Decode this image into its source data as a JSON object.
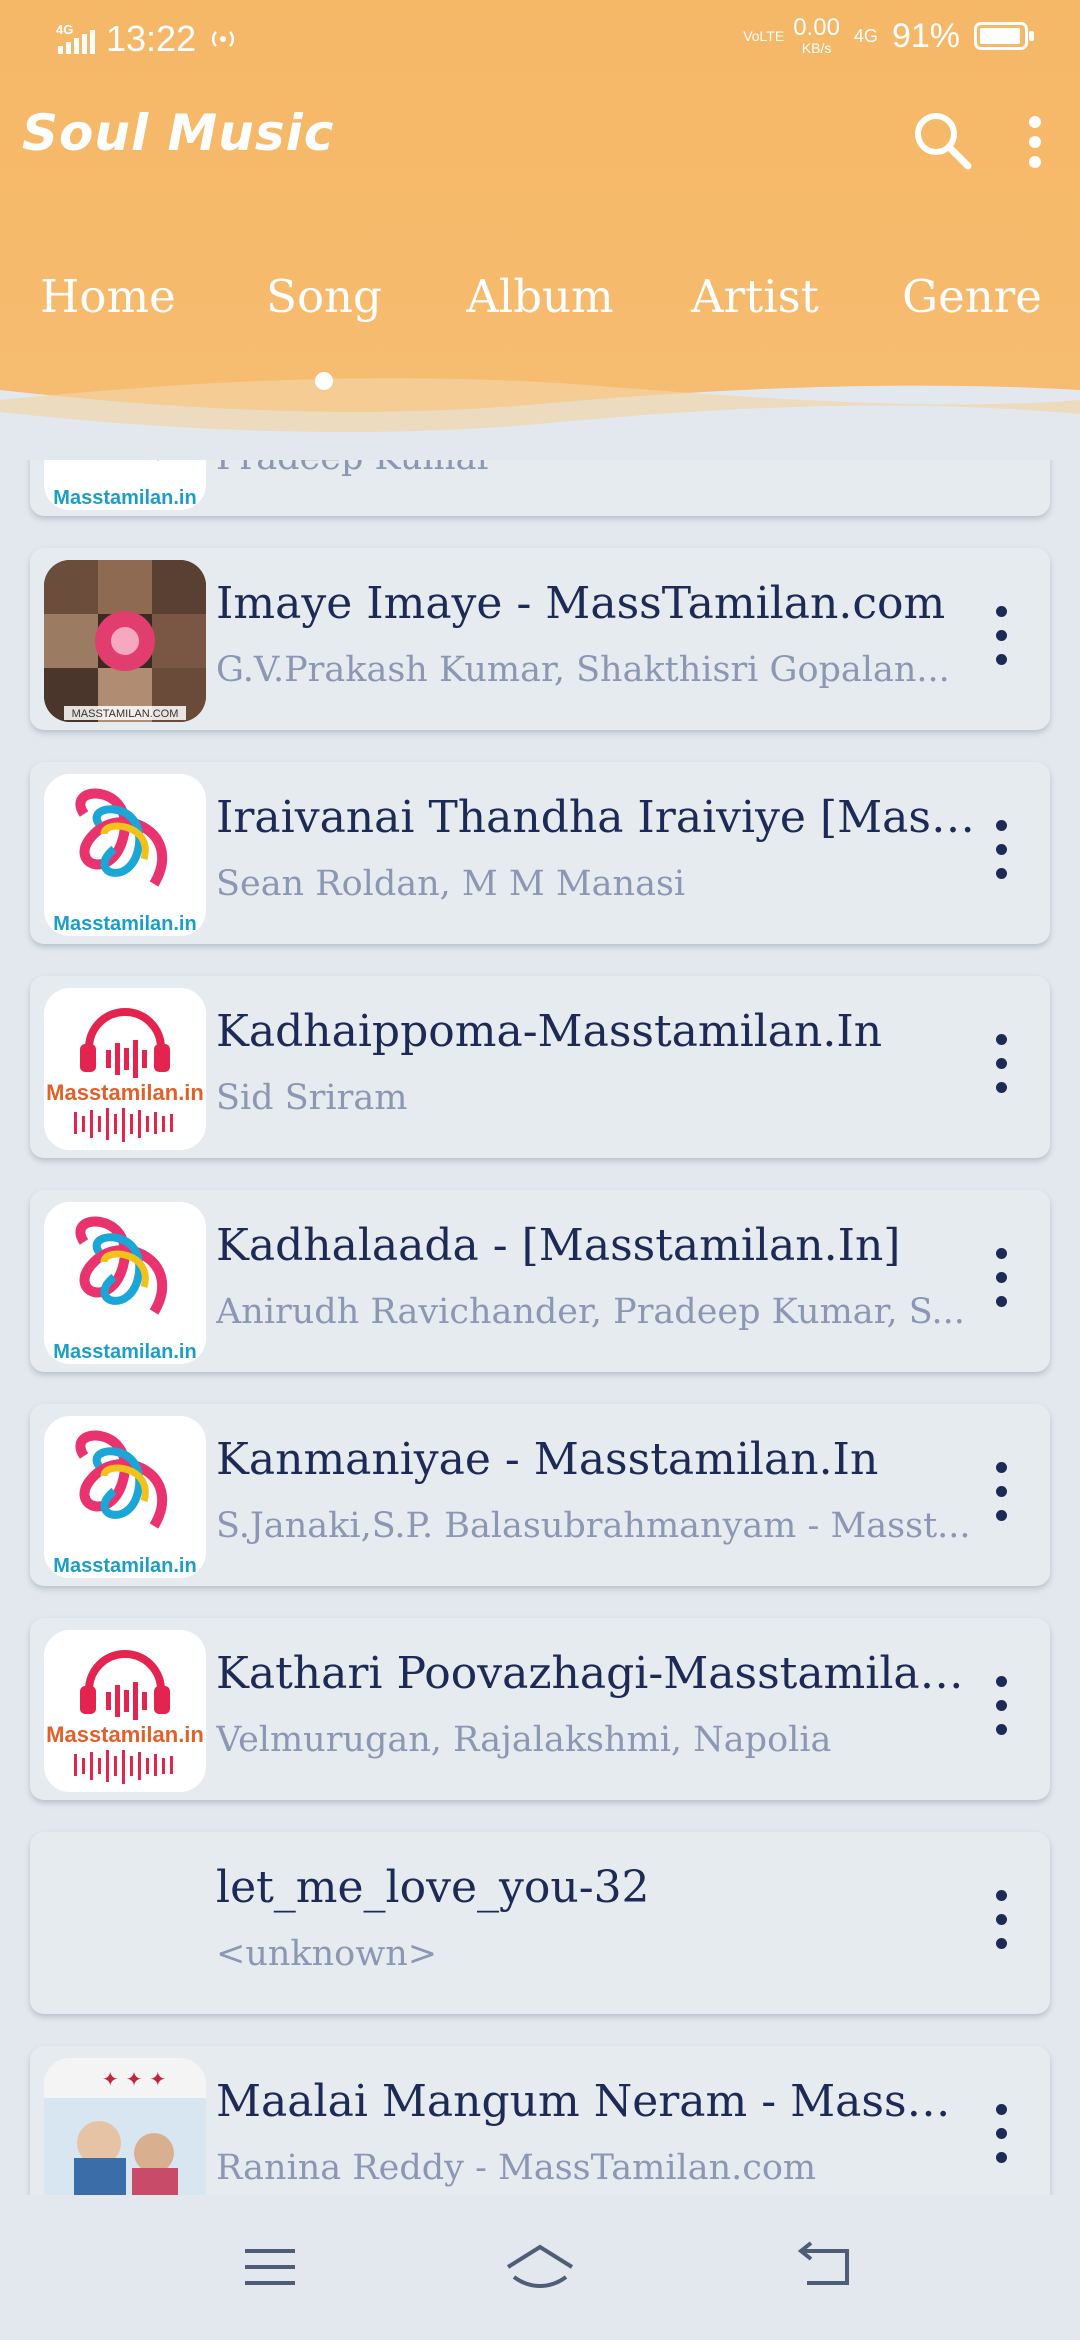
{
  "status_bar": {
    "network": "4G",
    "time": "13:22",
    "volte": "VoLTE",
    "speed_value": "0.00",
    "speed_unit": "KB/s",
    "network_right": "4G",
    "battery": "91%"
  },
  "app": {
    "title": "Soul Music",
    "icons": {
      "search": "search-icon",
      "more": "more-vertical-icon"
    }
  },
  "tabs": [
    {
      "label": "Home"
    },
    {
      "label": "Song",
      "active": true
    },
    {
      "label": "Album"
    },
    {
      "label": "Artist"
    },
    {
      "label": "Genre"
    }
  ],
  "songs": [
    {
      "title": "",
      "subtitle": "Pradeep Kumar",
      "art": "masstamilan-swirl"
    },
    {
      "title": "Imaye Imaye - MassTamilan.com",
      "subtitle": "G.V.Prakash Kumar, Shakthisri Gopalan...",
      "art": "photo-collage"
    },
    {
      "title": "Iraivanai Thandha Iraiviye [Mass...",
      "subtitle": "Sean Roldan, M M Manasi",
      "art": "masstamilan-swirl"
    },
    {
      "title": "Kadhaippoma-Masstamilan.In",
      "subtitle": "Sid Sriram",
      "art": "masstamilan-headphones"
    },
    {
      "title": "Kadhalaada - [Masstamilan.In]",
      "subtitle": "Anirudh Ravichander, Pradeep Kumar, S...",
      "art": "masstamilan-swirl"
    },
    {
      "title": "Kanmaniyae - Masstamilan.In",
      "subtitle": "S.Janaki,S.P. Balasubrahmanyam - Masst...",
      "art": "masstamilan-swirl"
    },
    {
      "title": "Kathari Poovazhagi-Masstamilan....",
      "subtitle": "Velmurugan, Rajalakshmi, Napolia",
      "art": "masstamilan-headphones"
    },
    {
      "title": "let_me_love_you-32",
      "subtitle": "<unknown>",
      "art": "none"
    },
    {
      "title": "Maalai Mangum Neram - MassTa...",
      "subtitle": "Ranina Reddy - MassTamilan.com",
      "art": "movie-poster"
    }
  ],
  "art_text": {
    "swirl_caption": "Masstamilan.in",
    "headphones_caption": "Masstamilan.in",
    "collage_caption": "MASSTAMILAN.COM"
  },
  "nav_bar": {
    "icons": [
      "menu-icon",
      "home-icon",
      "back-icon"
    ]
  },
  "colors": {
    "header": "#f5b867",
    "background": "#e2e8ee",
    "card": "#e6ebf0",
    "title_text": "#1d2a55",
    "subtitle_text": "#8b97b3"
  }
}
